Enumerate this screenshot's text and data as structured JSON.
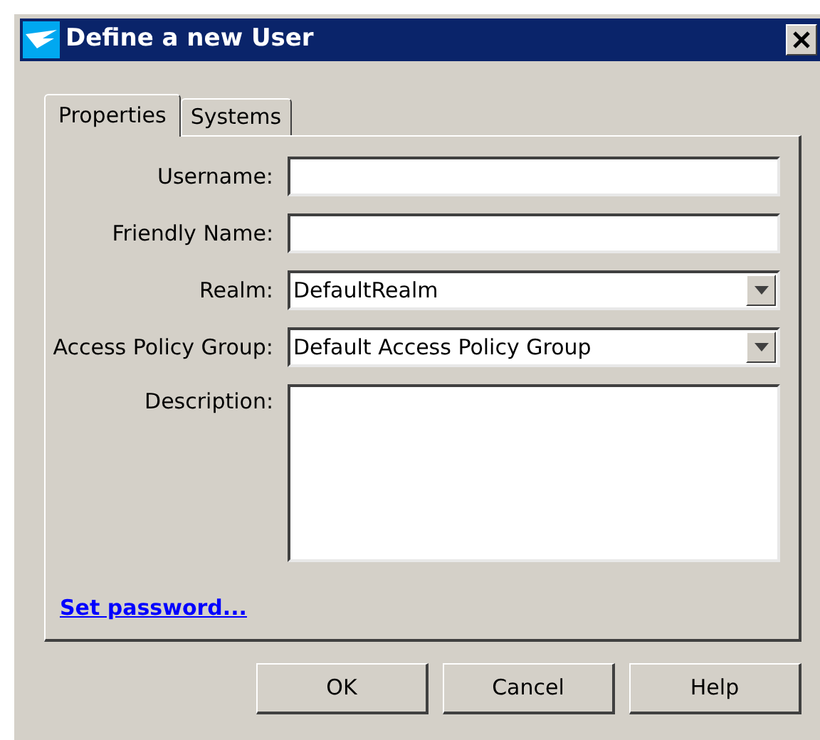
{
  "window": {
    "title": "Define a new User"
  },
  "tabs": [
    {
      "label": "Properties",
      "selected": true
    },
    {
      "label": "Systems",
      "selected": false
    }
  ],
  "fields": [
    {
      "kind": "text",
      "label": "Username:"
    },
    {
      "kind": "text",
      "label": "Friendly Name:"
    },
    {
      "kind": "select",
      "label": "Realm:",
      "value": "DefaultRealm"
    },
    {
      "kind": "select",
      "label": "Access Policy Group:",
      "value": "Default Access Policy Group"
    },
    {
      "kind": "textarea",
      "label": "Description:"
    }
  ],
  "link": "Set password...",
  "buttons": [
    "OK",
    "Cancel",
    "Help"
  ]
}
